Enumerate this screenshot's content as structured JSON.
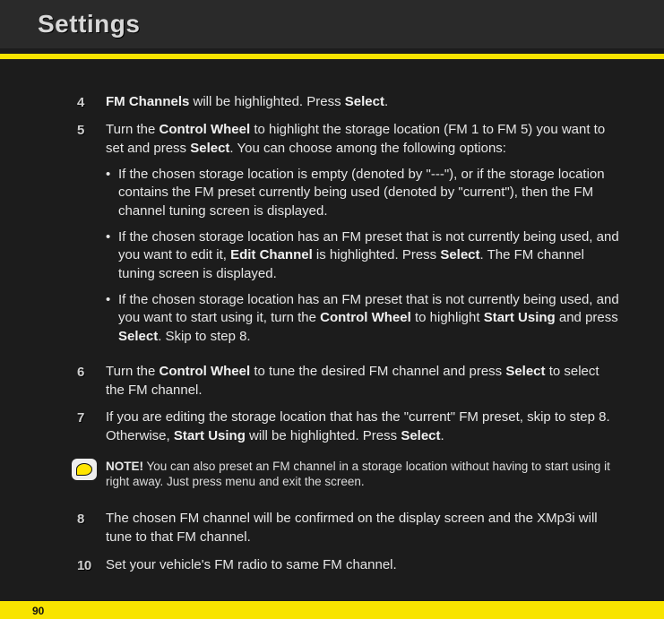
{
  "header": {
    "title": "Settings"
  },
  "steps": {
    "s4": {
      "num": "4",
      "pre": "FM Channels",
      "mid": " will be highlighted. Press ",
      "post": "Select",
      "end": "."
    },
    "s5": {
      "num": "5",
      "a": "Turn the ",
      "b": "Control Wheel",
      "c": " to highlight the storage location (FM 1 to FM 5) you want to set and press ",
      "d": "Select",
      "e": ". You can choose among the following options:"
    },
    "bullets": {
      "b1": {
        "text": "If the chosen storage location is empty (denoted by \"---\"), or if the storage location contains the FM preset currently being used (denoted by \"current\"), then the FM channel tuning screen is displayed."
      },
      "b2": {
        "a": "If the chosen storage location has an FM preset that is not currently being used, and you want to edit it, ",
        "b": "Edit Channel",
        "c": " is highlighted. Press ",
        "d": "Select",
        "e": ". The FM channel tuning screen is displayed."
      },
      "b3": {
        "a": "If the chosen storage location has an FM preset that is not currently being used, and you want to start using it, turn the ",
        "b": "Control Wheel",
        "c": " to highlight ",
        "d": "Start Using",
        "e": " and press ",
        "f": "Select",
        "g": ". Skip to step 8."
      }
    },
    "s6": {
      "num": "6",
      "a": "Turn the ",
      "b": "Control Wheel",
      "c": " to tune the desired FM channel and press ",
      "d": "Select",
      "e": " to select the FM channel."
    },
    "s7": {
      "num": "7",
      "a": "If you are editing the storage location that has the \"current\" FM preset, skip to step 8. Otherwise, ",
      "b": "Start Using",
      "c": " will be highlighted. Press ",
      "d": "Select",
      "e": "."
    },
    "note": {
      "label": "NOTE!",
      "text": " You can also preset an FM channel in a storage location without having to start using it right away. Just press menu and exit the screen."
    },
    "s8": {
      "num": "8",
      "text": "The chosen FM channel will be confirmed on the display screen and the XMp3i will tune to that FM channel."
    },
    "s10": {
      "num": "10",
      "text": "Set your vehicle's FM radio to same FM channel."
    }
  },
  "page": {
    "num": "90"
  }
}
